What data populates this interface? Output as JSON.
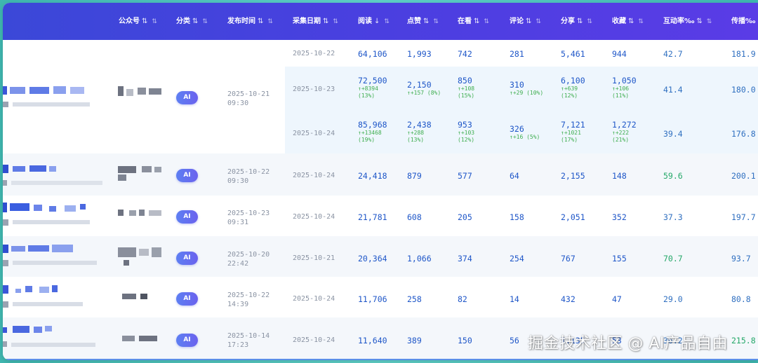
{
  "columns": [
    {
      "label": "公众号",
      "arrows": "⇅",
      "arrows2": "⇅"
    },
    {
      "label": "分类",
      "arrows": "⇅",
      "arrows2": "⇅"
    },
    {
      "label": "发布时间",
      "arrows": "⇅",
      "arrows2": "⇅"
    },
    {
      "label": "采集日期",
      "arrows": "⇅",
      "arrows2": "⇅"
    },
    {
      "label": "阅读",
      "arrows": "↓",
      "arrows2": "⇅"
    },
    {
      "label": "点赞",
      "arrows": "⇅",
      "arrows2": "⇅"
    },
    {
      "label": "在看",
      "arrows": "⇅",
      "arrows2": "⇅"
    },
    {
      "label": "评论",
      "arrows": "⇅",
      "arrows2": "⇅"
    },
    {
      "label": "分享",
      "arrows": "⇅",
      "arrows2": "⇅"
    },
    {
      "label": "收藏",
      "arrows": "⇅",
      "arrows2": "⇅"
    },
    {
      "label": "互动率‰",
      "arrows": "⇅",
      "arrows2": "⇅"
    },
    {
      "label": "传播‰",
      "arrows": "",
      "arrows2": ""
    }
  ],
  "rows": [
    {
      "category": "AI",
      "publish": [
        "2025-10-21",
        "09:30"
      ],
      "snapshots": [
        {
          "date": "2025-10-22",
          "read": "64,106",
          "like": "1,993",
          "watch": "742",
          "comment": "281",
          "share": "5,461",
          "fav": "944",
          "rate": "42.7",
          "spread": "181.9"
        },
        {
          "date": "2025-10-23",
          "read": "72,500",
          "read_d": [
            "↑+8394",
            "(13%)"
          ],
          "like": "2,150",
          "like_d": [
            "↑+157 (8%)"
          ],
          "watch": "850",
          "watch_d": [
            "↑+108",
            "(15%)"
          ],
          "comment": "310",
          "comment_d": [
            "↑+29 (10%)"
          ],
          "share": "6,100",
          "share_d": [
            "↑+639",
            "(12%)"
          ],
          "fav": "1,050",
          "fav_d": [
            "↑+106",
            "(11%)"
          ],
          "rate": "41.4",
          "spread": "180.0"
        },
        {
          "date": "2025-10-24",
          "read": "85,968",
          "read_d": [
            "↑+13468",
            "(19%)"
          ],
          "like": "2,438",
          "like_d": [
            "↑+288",
            "(13%)"
          ],
          "watch": "953",
          "watch_d": [
            "↑+103",
            "(12%)"
          ],
          "comment": "326",
          "comment_d": [
            "↑+16 (5%)"
          ],
          "share": "7,121",
          "share_d": [
            "↑+1021",
            "(17%)"
          ],
          "fav": "1,272",
          "fav_d": [
            "↑+222",
            "(21%)"
          ],
          "rate": "39.4",
          "spread": "176.8"
        }
      ]
    },
    {
      "category": "AI",
      "publish": [
        "2025-10-22",
        "09:30"
      ],
      "date": "2025-10-24",
      "read": "24,418",
      "like": "879",
      "watch": "577",
      "comment": "64",
      "share": "2,155",
      "fav": "148",
      "rate": "59.6",
      "spread": "200.1"
    },
    {
      "category": "AI",
      "publish": [
        "2025-10-23",
        "09:31"
      ],
      "date": "2025-10-24",
      "read": "21,781",
      "like": "608",
      "watch": "205",
      "comment": "158",
      "share": "2,051",
      "fav": "352",
      "rate": "37.3",
      "spread": "197.7"
    },
    {
      "category": "AI",
      "publish": [
        "2025-10-20",
        "22:42"
      ],
      "date": "2025-10-21",
      "read": "20,364",
      "like": "1,066",
      "watch": "374",
      "comment": "254",
      "share": "767",
      "fav": "155",
      "rate": "70.7",
      "spread": "93.7"
    },
    {
      "category": "AI",
      "publish": [
        "2025-10-22",
        "14:39"
      ],
      "date": "2025-10-24",
      "read": "11,706",
      "like": "258",
      "watch": "82",
      "comment": "14",
      "share": "432",
      "fav": "47",
      "rate": "29.0",
      "spread": "80.8"
    },
    {
      "category": "AI",
      "publish": [
        "2025-10-14",
        "17:23"
      ],
      "date": "2025-10-24",
      "read": "11,640",
      "like": "389",
      "watch": "150",
      "comment": "56",
      "share": "1,135",
      "fav": "53",
      "rate": "36.2",
      "spread": "215.8"
    }
  ],
  "watermark": "掘金技术社区 @ AI产品自由",
  "colors": {
    "header_start": "#3b48d8",
    "header_end": "#5a3ce6",
    "number": "#1e56c8",
    "delta": "#3fae4f",
    "rate_high": "#25a869",
    "tag": "#6b62ee"
  }
}
